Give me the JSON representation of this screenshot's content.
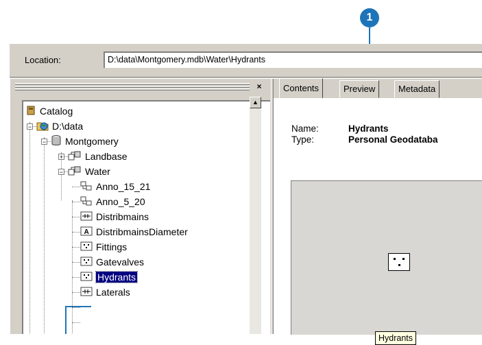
{
  "callout": {
    "number": "1"
  },
  "location": {
    "label": "Location:",
    "value": "D:\\data\\Montgomery.mdb\\Water\\Hydrants"
  },
  "tree": {
    "close_glyph": "×",
    "nodes": [
      {
        "label": "Catalog",
        "icon": "catalog-icon"
      },
      {
        "label": "D:\\data",
        "icon": "folder-globe-icon"
      },
      {
        "label": "Montgomery",
        "icon": "database-icon"
      },
      {
        "label": "Landbase",
        "icon": "feature-dataset-icon"
      },
      {
        "label": "Water",
        "icon": "feature-dataset-icon"
      },
      {
        "label": "Anno_15_21",
        "icon": "annotation-icon"
      },
      {
        "label": "Anno_5_20",
        "icon": "annotation-icon"
      },
      {
        "label": "Distribmains",
        "icon": "line-featureclass-icon"
      },
      {
        "label": "DistribmainsDiameter",
        "icon": "annotation-A-icon"
      },
      {
        "label": "Fittings",
        "icon": "point-featureclass-icon"
      },
      {
        "label": "Gatevalves",
        "icon": "point-featureclass-icon"
      },
      {
        "label": "Hydrants",
        "icon": "point-featureclass-icon"
      },
      {
        "label": "Laterals",
        "icon": "line-featureclass-icon"
      }
    ]
  },
  "tabs": [
    {
      "label": "Contents"
    },
    {
      "label": "Preview"
    },
    {
      "label": "Metadata"
    }
  ],
  "details": {
    "name_label": "Name:",
    "name_value": "Hydrants",
    "type_label": "Type:",
    "type_value": "Personal Geodataba"
  },
  "preview": {
    "label": "Hydrants"
  }
}
